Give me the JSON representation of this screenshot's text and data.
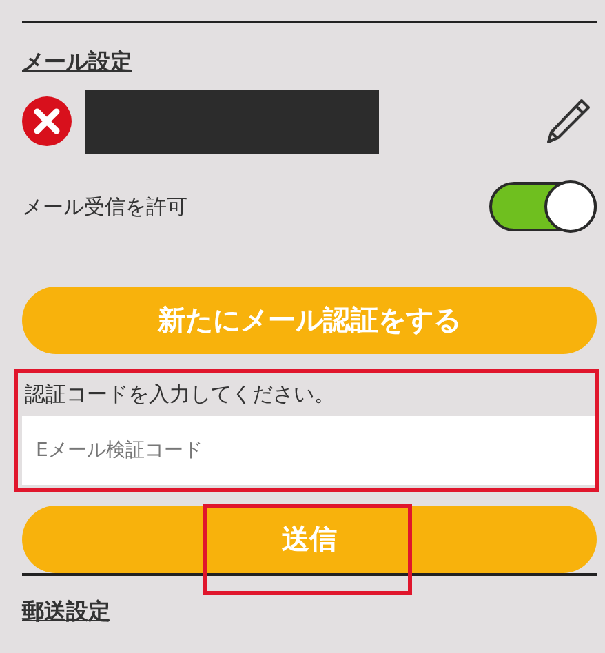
{
  "mail_settings": {
    "title": "メール設定",
    "address_verified": false,
    "allow_receive": {
      "label": "メール受信を許可",
      "on": true
    }
  },
  "reauth_button": "新たにメール認証をする",
  "code_entry": {
    "prompt": "認証コードを入力してください。",
    "placeholder": "Eメール検証コード"
  },
  "submit_button": "送信",
  "postal_settings": {
    "title": "郵送設定"
  }
}
